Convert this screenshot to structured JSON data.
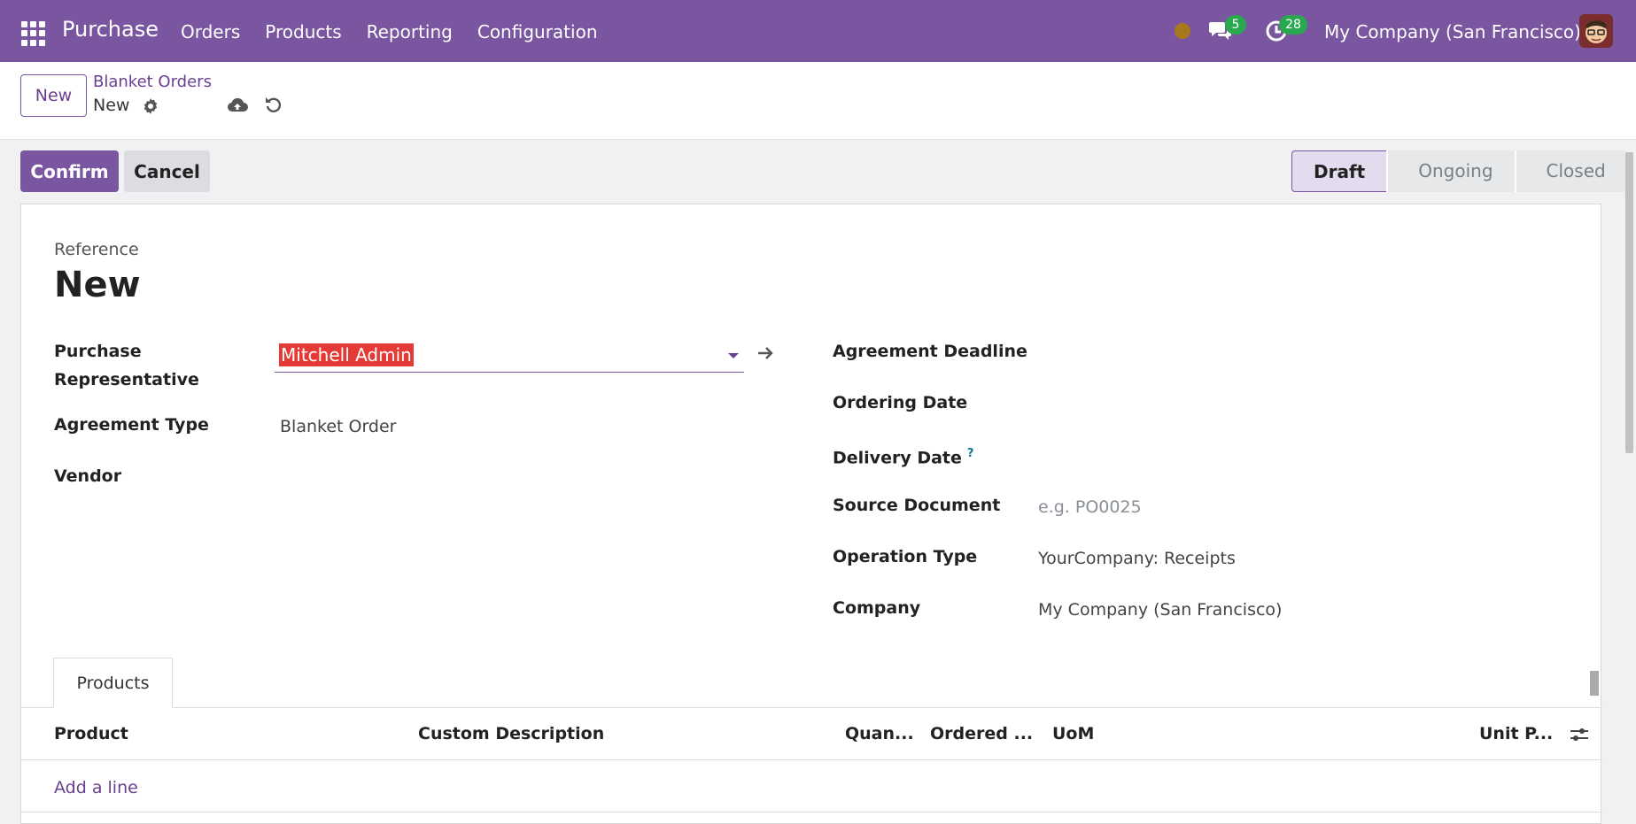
{
  "navbar": {
    "app_title": "Purchase",
    "menu": [
      "Orders",
      "Products",
      "Reporting",
      "Configuration"
    ],
    "chat_count": "5",
    "activity_count": "28",
    "company": "My Company (San Francisco)"
  },
  "control": {
    "new_label": "New",
    "breadcrumb_parent": "Blanket Orders",
    "breadcrumb_current": "New"
  },
  "actions": {
    "confirm_label": "Confirm",
    "cancel_label": "Cancel",
    "stages": [
      "Draft",
      "Ongoing",
      "Closed"
    ],
    "active_stage": "Draft"
  },
  "form": {
    "reference_label": "Reference",
    "reference_value": "New",
    "left_fields": {
      "rep_label": "Purchase Representative",
      "rep_value": "Mitchell Admin",
      "agreement_type_label": "Agreement Type",
      "agreement_type_value": "Blanket Order",
      "vendor_label": "Vendor"
    },
    "right_fields": {
      "deadline_label": "Agreement Deadline",
      "ordering_date_label": "Ordering Date",
      "delivery_date_label": "Delivery Date",
      "delivery_help": "?",
      "source_label": "Source Document",
      "source_placeholder": "e.g. PO0025",
      "operation_label": "Operation Type",
      "operation_value": "YourCompany: Receipts",
      "company_label": "Company",
      "company_value": "My Company (San Francisco)"
    }
  },
  "products": {
    "tab_label": "Products",
    "columns": [
      "Product",
      "Custom Description",
      "Quan...",
      "Ordered ...",
      "UoM",
      "Unit P..."
    ],
    "add_line": "Add a line"
  },
  "colors": {
    "brand": "#7a55a0",
    "badge": "#2aa84f",
    "highlight": "#e53935"
  }
}
